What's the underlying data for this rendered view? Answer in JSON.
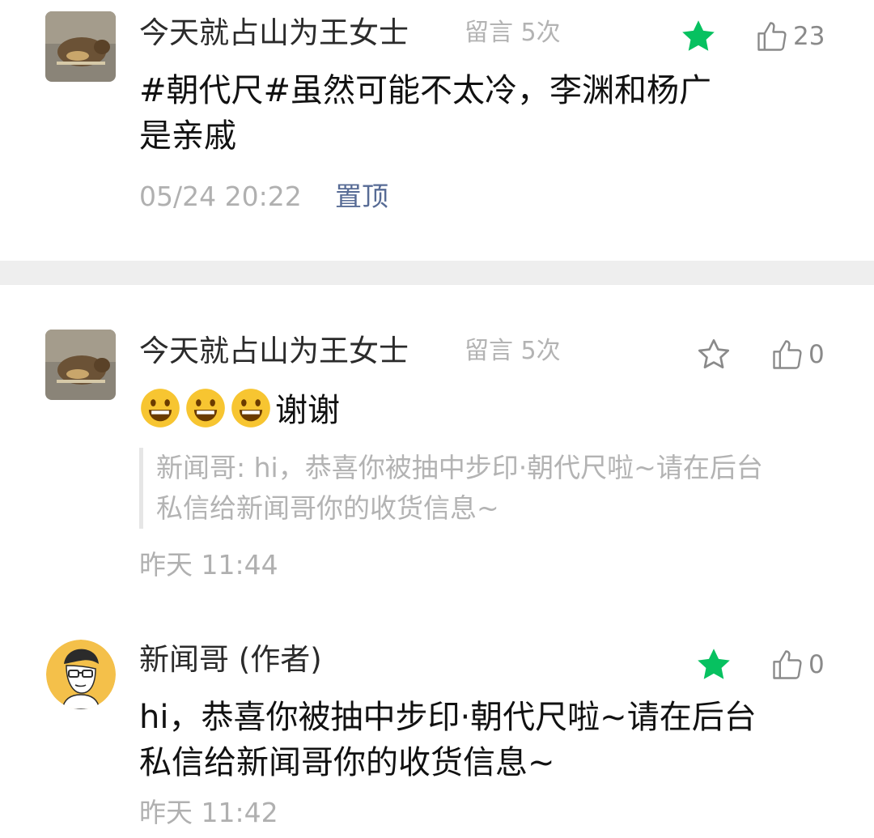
{
  "comments": [
    {
      "author": "今天就占山为王女士",
      "badge": "留言 5次",
      "content": "#朝代尺#虽然可能不太冷，李渊和杨广是亲戚",
      "time": "05/24 20:22",
      "pin_label": "置顶",
      "starred": true,
      "likes": "23",
      "avatar": "hamster-avatar"
    },
    {
      "author": "今天就占山为王女士",
      "badge": "留言 5次",
      "content": "谢谢",
      "emoji_count": 3,
      "quote": "新闻哥: hi，恭喜你被抽中步印·朝代尺啦~请在后台私信给新闻哥你的收货信息~",
      "time": "昨天 11:44",
      "starred": false,
      "likes": "0",
      "avatar": "hamster-avatar"
    },
    {
      "author": "新闻哥 (作者)",
      "content": "hi，恭喜你被抽中步印·朝代尺啦~请在后台私信给新闻哥你的收货信息~",
      "time": "昨天 11:42",
      "starred": true,
      "likes": "0",
      "avatar": "cartoon-man-avatar"
    }
  ],
  "colors": {
    "star_active": "#07c160",
    "star_inactive": "#8a8a8a",
    "link": "#576b95",
    "secondary_text": "#b0b0b0",
    "divider": "#eeeeee"
  }
}
